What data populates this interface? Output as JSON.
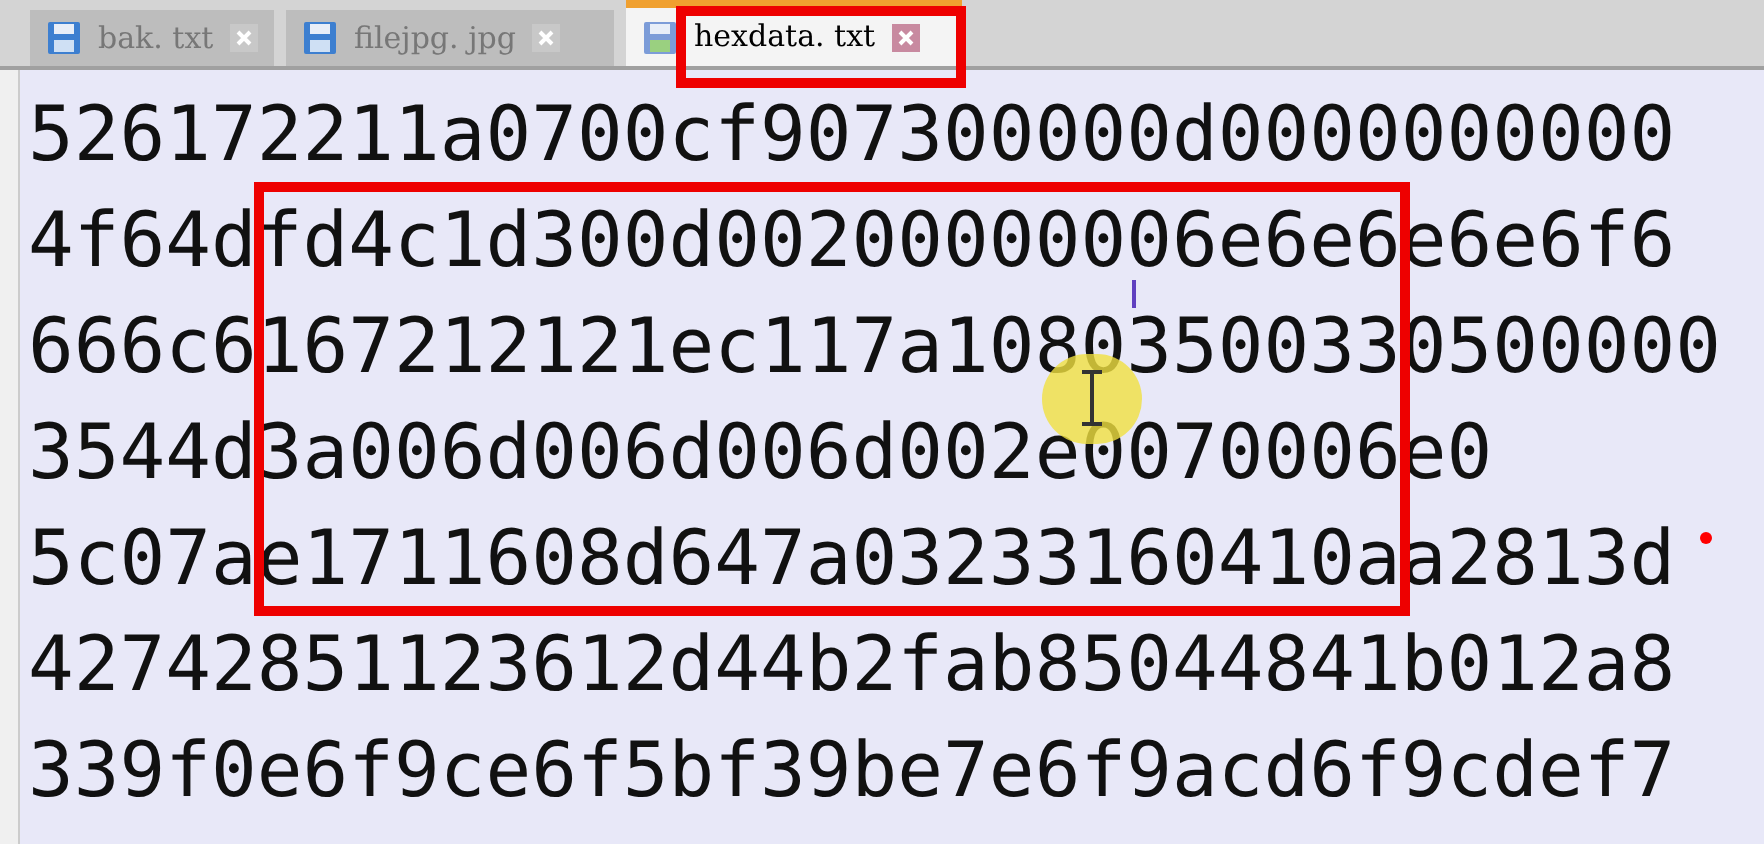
{
  "tabs": [
    {
      "label": "bak. txt",
      "selected": false
    },
    {
      "label": "filejpg. jpg",
      "selected": false
    },
    {
      "label": "hexdata. txt",
      "selected": true
    }
  ],
  "lines": [
    "526172211a0700cf907300000d0000000000",
    "4f64dfd4c1d300d00200000006e6e6e6e6f6",
    "666c6167212121ec117a10803500330500000",
    "3544d3a006d006d006d002e0070006e0",
    "5c07ae1711608d647a03233160410aa2813d",
    "42742851123612d44b2fab85044841b012a8",
    "339f0e6f9ce6f5bf39be7e6f9acd6f9cdef7"
  ]
}
